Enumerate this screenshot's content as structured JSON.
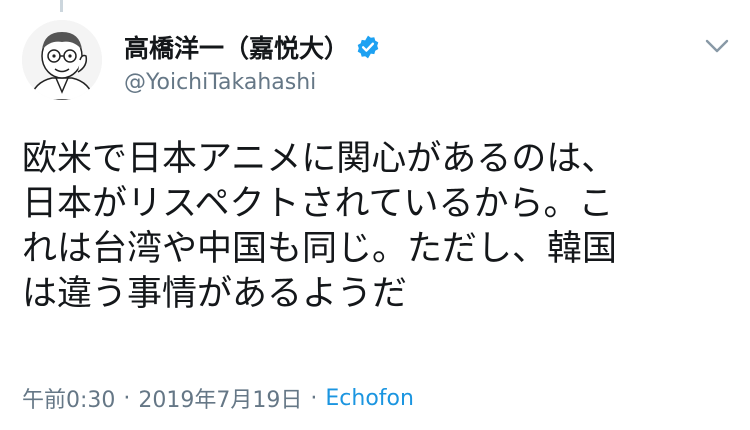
{
  "author": {
    "display_name": "高橋洋一（嘉悦大）",
    "handle": "@YoichiTakahashi",
    "verified": true
  },
  "tweet": {
    "lines": [
      "欧米で日本アニメに関心があるのは、",
      "日本がリスペクトされているから。こ",
      "れは台湾や中国も同じ。ただし、韓国",
      "は違う事情があるようだ"
    ]
  },
  "meta": {
    "time": "午前0:30",
    "separator": "·",
    "date": "2019年7月19日",
    "source": "Echofon"
  },
  "colors": {
    "text": "#14171a",
    "secondary": "#657786",
    "link": "#1b95e0",
    "verified": "#1da1f2"
  },
  "icons": {
    "verified": "verified-badge-icon",
    "caret": "chevron-down-icon"
  }
}
